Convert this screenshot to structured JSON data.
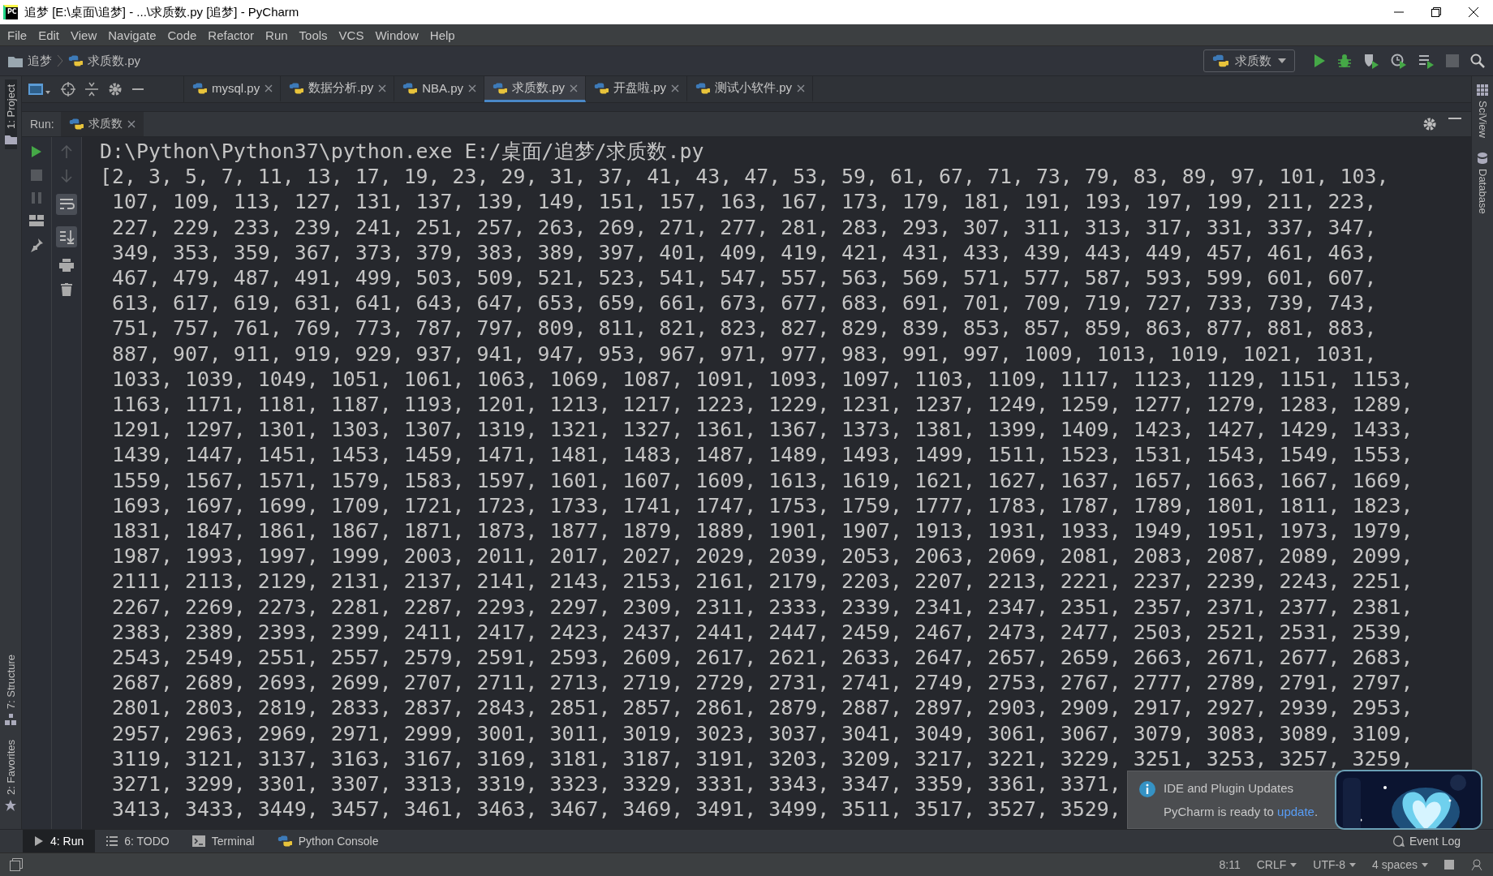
{
  "window": {
    "app_icon": "PC",
    "title": "追梦 [E:\\桌面\\追梦] - ...\\求质数.py [追梦] - PyCharm"
  },
  "menu": [
    "File",
    "Edit",
    "View",
    "Navigate",
    "Code",
    "Refactor",
    "Run",
    "Tools",
    "VCS",
    "Window",
    "Help"
  ],
  "breadcrumb": [
    "追梦",
    "求质数.py"
  ],
  "run_config": {
    "label": "求质数"
  },
  "left_stripe": {
    "top": [
      "1: Project"
    ],
    "bottom": [
      "7: Structure",
      "2: Favorites"
    ]
  },
  "right_stripe": [
    "SciView",
    "Database"
  ],
  "editor_tabs": [
    {
      "label": "mysql.py",
      "selected": false
    },
    {
      "label": "数据分析.py",
      "selected": false
    },
    {
      "label": "NBA.py",
      "selected": false
    },
    {
      "label": "求质数.py",
      "selected": true
    },
    {
      "label": "开盘啦.py",
      "selected": false
    },
    {
      "label": "测试小软件.py",
      "selected": false
    }
  ],
  "run_panel": {
    "label": "Run:",
    "tab": "求质数"
  },
  "console_lines": [
    "D:\\Python\\Python37\\python.exe E:/桌面/追梦/求质数.py",
    "[2, 3, 5, 7, 11, 13, 17, 19, 23, 29, 31, 37, 41, 43, 47, 53, 59, 61, 67, 71, 73, 79, 83, 89, 97, 101, 103,",
    " 107, 109, 113, 127, 131, 137, 139, 149, 151, 157, 163, 167, 173, 179, 181, 191, 193, 197, 199, 211, 223,",
    " 227, 229, 233, 239, 241, 251, 257, 263, 269, 271, 277, 281, 283, 293, 307, 311, 313, 317, 331, 337, 347,",
    " 349, 353, 359, 367, 373, 379, 383, 389, 397, 401, 409, 419, 421, 431, 433, 439, 443, 449, 457, 461, 463,",
    " 467, 479, 487, 491, 499, 503, 509, 521, 523, 541, 547, 557, 563, 569, 571, 577, 587, 593, 599, 601, 607,",
    " 613, 617, 619, 631, 641, 643, 647, 653, 659, 661, 673, 677, 683, 691, 701, 709, 719, 727, 733, 739, 743,",
    " 751, 757, 761, 769, 773, 787, 797, 809, 811, 821, 823, 827, 829, 839, 853, 857, 859, 863, 877, 881, 883,",
    " 887, 907, 911, 919, 929, 937, 941, 947, 953, 967, 971, 977, 983, 991, 997, 1009, 1013, 1019, 1021, 1031,",
    " 1033, 1039, 1049, 1051, 1061, 1063, 1069, 1087, 1091, 1093, 1097, 1103, 1109, 1117, 1123, 1129, 1151, 1153,",
    " 1163, 1171, 1181, 1187, 1193, 1201, 1213, 1217, 1223, 1229, 1231, 1237, 1249, 1259, 1277, 1279, 1283, 1289,",
    " 1291, 1297, 1301, 1303, 1307, 1319, 1321, 1327, 1361, 1367, 1373, 1381, 1399, 1409, 1423, 1427, 1429, 1433,",
    " 1439, 1447, 1451, 1453, 1459, 1471, 1481, 1483, 1487, 1489, 1493, 1499, 1511, 1523, 1531, 1543, 1549, 1553,",
    " 1559, 1567, 1571, 1579, 1583, 1597, 1601, 1607, 1609, 1613, 1619, 1621, 1627, 1637, 1657, 1663, 1667, 1669,",
    " 1693, 1697, 1699, 1709, 1721, 1723, 1733, 1741, 1747, 1753, 1759, 1777, 1783, 1787, 1789, 1801, 1811, 1823,",
    " 1831, 1847, 1861, 1867, 1871, 1873, 1877, 1879, 1889, 1901, 1907, 1913, 1931, 1933, 1949, 1951, 1973, 1979,",
    " 1987, 1993, 1997, 1999, 2003, 2011, 2017, 2027, 2029, 2039, 2053, 2063, 2069, 2081, 2083, 2087, 2089, 2099,",
    " 2111, 2113, 2129, 2131, 2137, 2141, 2143, 2153, 2161, 2179, 2203, 2207, 2213, 2221, 2237, 2239, 2243, 2251,",
    " 2267, 2269, 2273, 2281, 2287, 2293, 2297, 2309, 2311, 2333, 2339, 2341, 2347, 2351, 2357, 2371, 2377, 2381,",
    " 2383, 2389, 2393, 2399, 2411, 2417, 2423, 2437, 2441, 2447, 2459, 2467, 2473, 2477, 2503, 2521, 2531, 2539,",
    " 2543, 2549, 2551, 2557, 2579, 2591, 2593, 2609, 2617, 2621, 2633, 2647, 2657, 2659, 2663, 2671, 2677, 2683,",
    " 2687, 2689, 2693, 2699, 2707, 2711, 2713, 2719, 2729, 2731, 2741, 2749, 2753, 2767, 2777, 2789, 2791, 2797,",
    " 2801, 2803, 2819, 2833, 2837, 2843, 2851, 2857, 2861, 2879, 2887, 2897, 2903, 2909, 2917, 2927, 2939, 2953,",
    " 2957, 2963, 2969, 2971, 2999, 3001, 3011, 3019, 3023, 3037, 3041, 3049, 3061, 3067, 3079, 3083, 3089, 3109,",
    " 3119, 3121, 3137, 3163, 3167, 3169, 3181, 3187, 3191, 3203, 3209, 3217, 3221, 3229, 3251, 3253, 3257, 3259,",
    " 3271, 3299, 3301, 3307, 3313, 3319, 3323, 3329, 3331, 3343, 3347, 3359, 3361, 3371,",
    " 3413, 3433, 3449, 3457, 3461, 3463, 3467, 3469, 3491, 3499, 3511, 3517, 3527, 3529,"
  ],
  "notification": {
    "title": "IDE and Plugin Updates",
    "message": "PyCharm is ready to",
    "link": "update",
    "end": "."
  },
  "bottom_tabs": [
    {
      "label": "4: Run",
      "selected": true
    },
    {
      "label": "6: TODO",
      "selected": false
    },
    {
      "label": "Terminal",
      "selected": false
    },
    {
      "label": "Python Console",
      "selected": false
    }
  ],
  "event_log": "Event Log",
  "status_bar": [
    {
      "label": "8:11",
      "dropdown": false
    },
    {
      "label": "CRLF",
      "dropdown": true
    },
    {
      "label": "UTF-8",
      "dropdown": true
    },
    {
      "label": "4 spaces",
      "dropdown": true
    }
  ]
}
